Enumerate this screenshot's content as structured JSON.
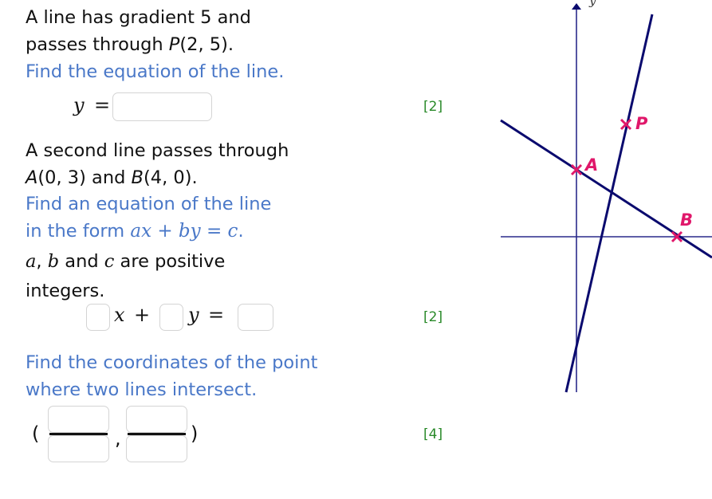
{
  "q1": {
    "line1": "A line has gradient 5 and",
    "line2_pre": "passes through ",
    "point_label": "P",
    "point_coords": "(2, 5).",
    "instruction": "Find the equation of the line.",
    "lhs": "y",
    "eq": "=",
    "answer_value": "",
    "marks": "[2]"
  },
  "q2": {
    "line1": "A second line passes through",
    "a_label": "A",
    "a_coords": "(0, 3) and ",
    "b_label": "B",
    "b_coords": "(4, 0).",
    "instruction1": "Find an equation of the line",
    "instruction2_pre": "in the form ",
    "form": "ax + by = c",
    "instruction2_post": ".",
    "cond_a": "a",
    "cond_comma": ", ",
    "cond_b": "b",
    "cond_and": " and ",
    "cond_c": "c",
    "cond_rest": " are positive",
    "cond_line2": "integers.",
    "x_sym": "x",
    "plus": "+",
    "y_sym": "y",
    "eq": "=",
    "a_value": "",
    "b_value": "",
    "c_value": "",
    "marks": "[2]"
  },
  "q3": {
    "instruction1": "Find the coordinates of the point",
    "instruction2": "where two lines intersect.",
    "open_paren": "(",
    "comma": ",",
    "close_paren": ")",
    "x_num": "",
    "x_den": "",
    "y_num": "",
    "y_den": "",
    "marks": "[4]"
  },
  "diagram": {
    "y_axis_label": "y",
    "point_p": "P",
    "point_a": "A",
    "point_b": "B",
    "line_color": "#0a0a6e",
    "axis_color": "#2a2a8a",
    "marker_color": "#e0176a"
  }
}
